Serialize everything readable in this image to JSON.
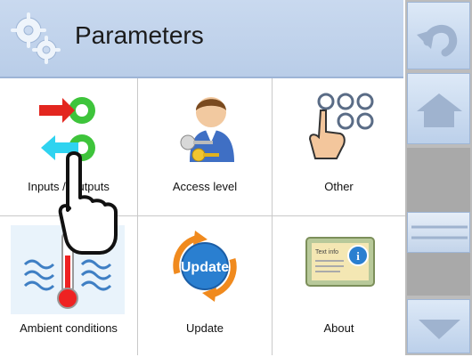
{
  "header": {
    "title": "Parameters",
    "icon": "gears-icon"
  },
  "tiles": [
    {
      "label": "Inputs / Outputs",
      "icon": "inputs-outputs-icon"
    },
    {
      "label": "Access level",
      "icon": "user-keys-icon"
    },
    {
      "label": "Other",
      "icon": "keypad-hand-icon"
    },
    {
      "label": "Ambient conditions",
      "icon": "thermometer-icon"
    },
    {
      "label": "Update",
      "icon": "update-icon"
    },
    {
      "label": "About",
      "icon": "info-card-icon"
    }
  ],
  "sidebar": {
    "back": "undo-arrow-icon",
    "home": "home-icon",
    "down": "chevron-down-icon"
  },
  "card_text": "Text info",
  "update_badge": "Update"
}
